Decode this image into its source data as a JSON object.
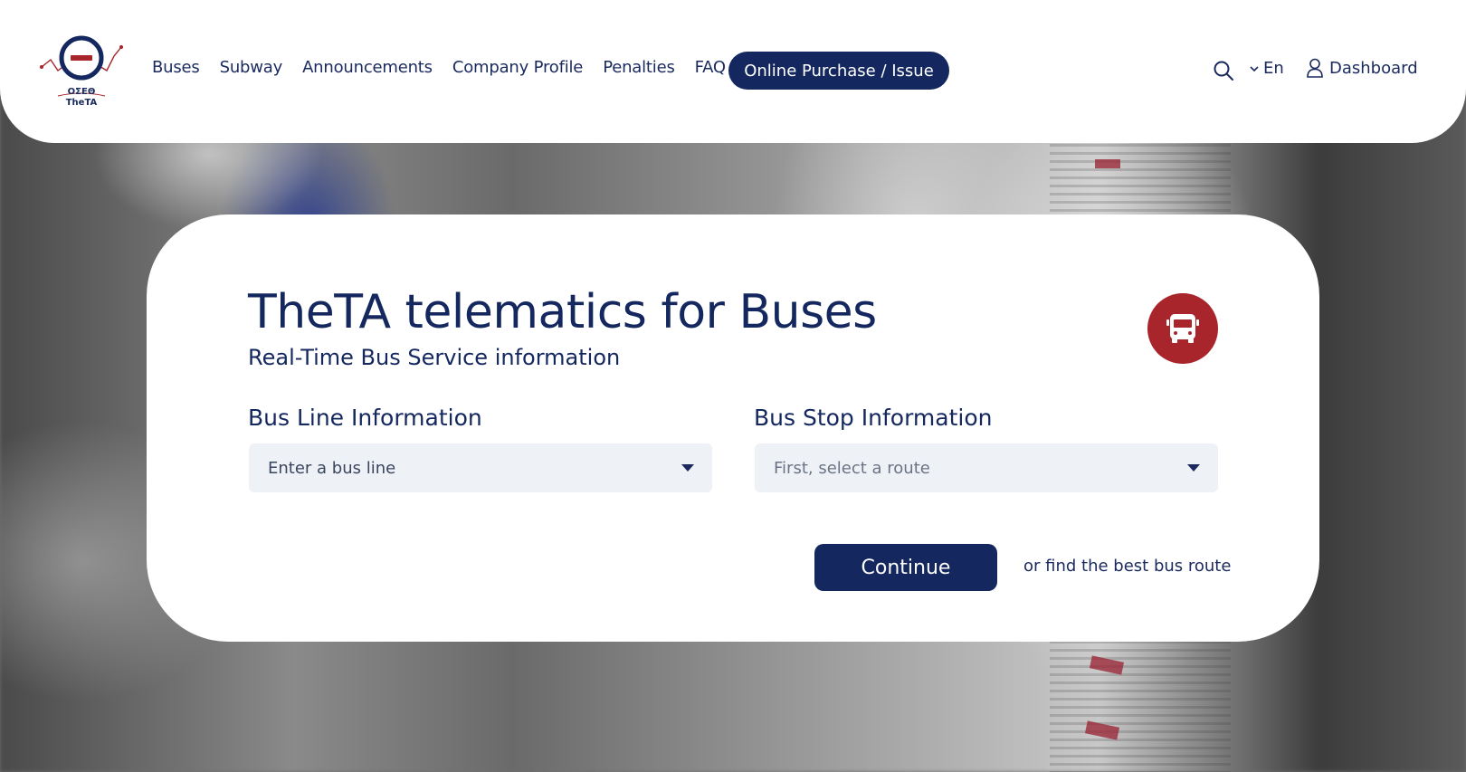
{
  "brand": {
    "logo_line1": "ΟΣΕΘ",
    "logo_line2": "TheTA",
    "accent_color": "#a8252c",
    "primary_color": "#14285f"
  },
  "nav": {
    "items": [
      "Buses",
      "Subway",
      "Announcements",
      "Company Profile",
      "Penalties",
      "FAQ"
    ],
    "cta_label": "Online Purchase / Issue",
    "language": "En",
    "dashboard_label": "Dashboard"
  },
  "card": {
    "title": "TheTA telematics for Buses",
    "subtitle": "Real-Time Bus Service information",
    "bus_line_label": "Bus Line Information",
    "bus_line_placeholder": "Enter a bus line",
    "bus_stop_label": "Bus Stop Information",
    "bus_stop_placeholder": "First, select a route",
    "continue_label": "Continue",
    "alt_link": "or find the best bus route"
  },
  "icons": {
    "logo": "theta-logo-icon",
    "search": "search-icon",
    "language_chevron": "chevron-down-icon",
    "user": "user-icon",
    "bus": "bus-icon"
  }
}
